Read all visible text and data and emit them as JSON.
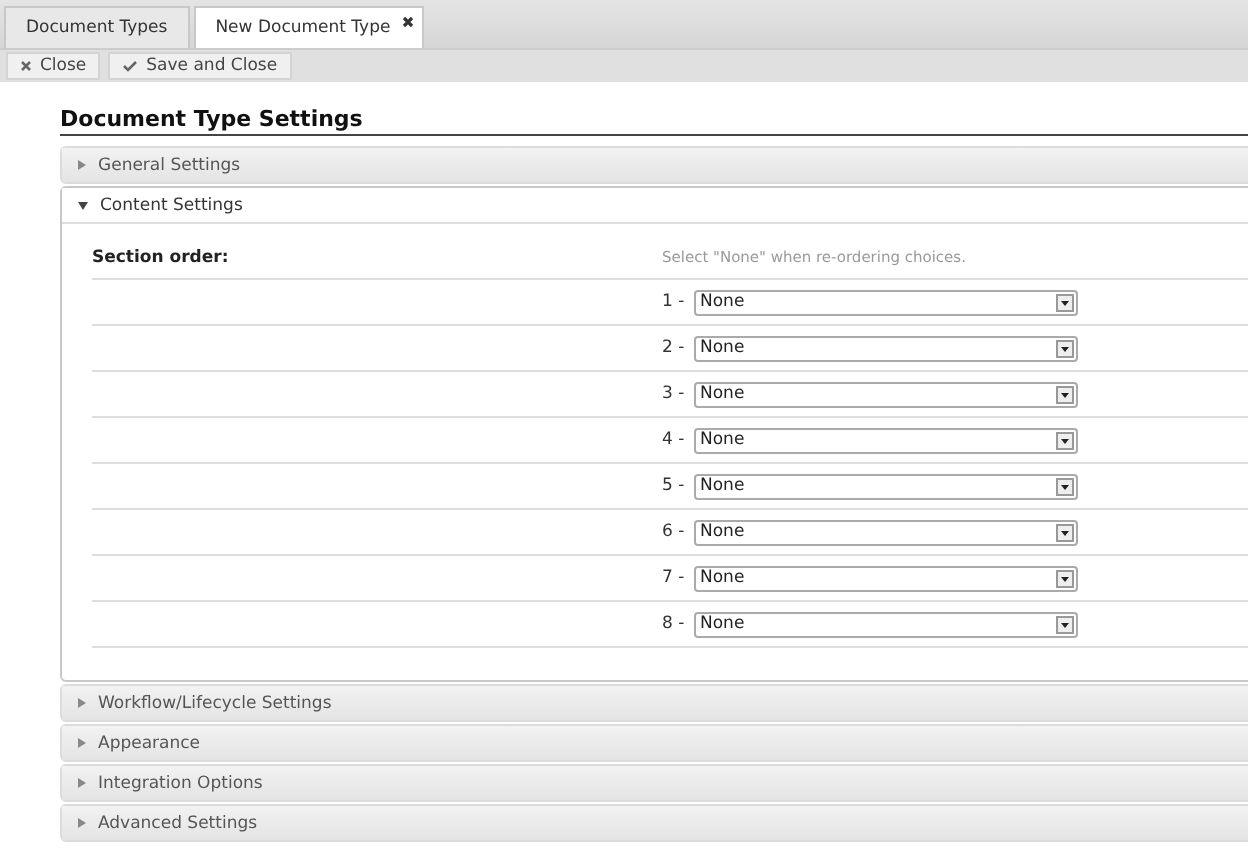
{
  "tabs": [
    {
      "label": "Document Types",
      "selected": false,
      "closable": false
    },
    {
      "label": "New Document Type",
      "selected": true,
      "closable": true
    }
  ],
  "toolbar": [
    {
      "label": "Close",
      "kind": "close"
    },
    {
      "label": "Save and Close",
      "kind": "save"
    }
  ],
  "heading": "Document Type Settings",
  "sections": [
    {
      "title": "General Settings",
      "expanded": false
    },
    {
      "title": "Content Settings",
      "expanded": true,
      "field_label": "Section order:",
      "hint": "Select \"None\" when re-ordering choices.",
      "rows": [
        {
          "number": "1 -",
          "value": "None"
        },
        {
          "number": "2 -",
          "value": "None"
        },
        {
          "number": "3 -",
          "value": "None"
        },
        {
          "number": "4 -",
          "value": "None"
        },
        {
          "number": "5 -",
          "value": "None"
        },
        {
          "number": "6 -",
          "value": "None"
        },
        {
          "number": "7 -",
          "value": "None"
        },
        {
          "number": "8 -",
          "value": "None"
        }
      ]
    },
    {
      "title": "Workflow/Lifecycle Settings",
      "expanded": false
    },
    {
      "title": "Appearance",
      "expanded": false
    },
    {
      "title": "Integration Options",
      "expanded": false
    },
    {
      "title": "Advanced Settings",
      "expanded": false
    }
  ]
}
